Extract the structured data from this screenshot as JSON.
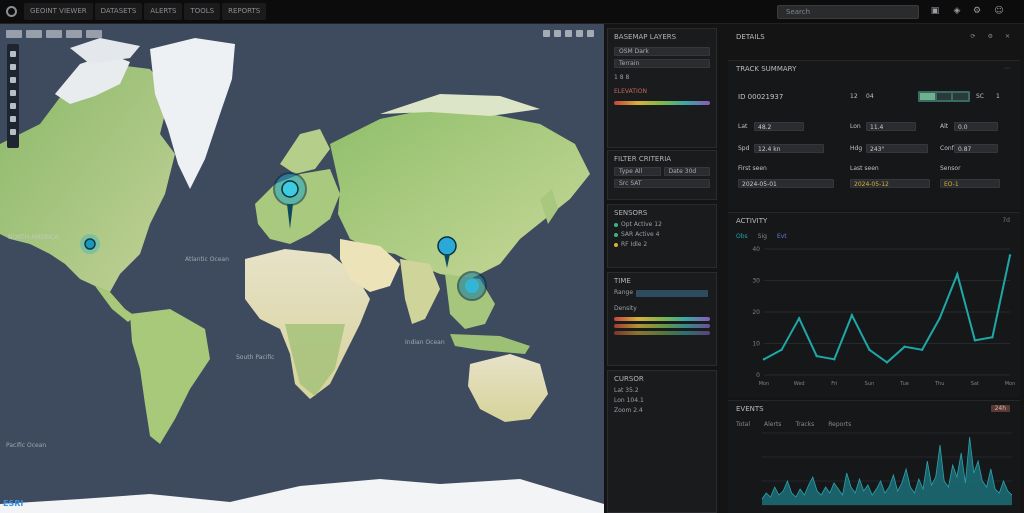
{
  "app": {
    "tabs": [
      "GEOINT VIEWER",
      "DATASETS",
      "ALERTS",
      "TOOLS",
      "REPORTS"
    ],
    "search_placeholder": "Search"
  },
  "map": {
    "attribution": "ESRI",
    "labels": [
      {
        "text": "NORTH AMERICA",
        "class": "ocean"
      },
      {
        "text": "Pacific Ocean",
        "class": "ocean"
      },
      {
        "text": "Atlantic Ocean",
        "class": "ocean"
      },
      {
        "text": "Indian Ocean",
        "class": "ocean"
      },
      {
        "text": "South Pacific",
        "class": "ocean"
      }
    ],
    "markers": [
      {
        "name": "marker-north-america"
      },
      {
        "name": "marker-europe"
      },
      {
        "name": "marker-china"
      },
      {
        "name": "marker-southeast-asia"
      }
    ]
  },
  "layers_panel": {
    "title": "BASEMAP LAYERS",
    "field1": "OSM Dark",
    "field2": "Terrain",
    "row_label": "1 8 8",
    "legend_title": "ELEVATION"
  },
  "filters_panel": {
    "title": "FILTER CRITERIA",
    "items": [
      {
        "k": "Type",
        "v": "All"
      },
      {
        "k": "Date",
        "v": "30d"
      },
      {
        "k": "Src",
        "v": "SAT"
      }
    ]
  },
  "stats_panel": {
    "title": "SENSORS",
    "items": [
      {
        "k": "Opt",
        "v": "Active 12"
      },
      {
        "k": "SAR",
        "v": "Active 4"
      },
      {
        "k": "RF",
        "v": "Idle 2"
      }
    ]
  },
  "timeline_panel": {
    "title": "TIME",
    "slider_label": "Range",
    "bars_label": "Density"
  },
  "coords_panel": {
    "title": "CURSOR",
    "lines": [
      "Lat 35.2",
      "Lon 104.1",
      "Zoom 2.4"
    ]
  },
  "right": {
    "header": "DETAILS",
    "header_icons": [
      "refresh",
      "settings",
      "close"
    ],
    "summary_title": "TRACK SUMMARY",
    "summary_id": "ID 00021937",
    "summary_badges": [
      "12",
      "04",
      "SC",
      "1"
    ],
    "summary_rows": [
      {
        "k": "Lat",
        "v": "48.2"
      },
      {
        "k": "Lon",
        "v": "11.4"
      },
      {
        "k": "Alt",
        "v": "0.0"
      },
      {
        "k": "Spd",
        "v": "12.4 kn"
      },
      {
        "k": "Hdg",
        "v": "243°"
      },
      {
        "k": "Conf",
        "v": "0.87"
      },
      {
        "k": "First seen",
        "v": "2024-05-01"
      },
      {
        "k": "Last seen",
        "v": "2024-05-12"
      },
      {
        "k": "Sensor",
        "v": "EO-1"
      }
    ],
    "activity_title": "ACTIVITY",
    "activity_legend": [
      "Obs",
      "Sig",
      "Evt"
    ],
    "activity_corner": "7d",
    "events_title": "EVENTS",
    "events_corner": "24h",
    "events_legend": [
      "Total",
      "Alerts",
      "Tracks",
      "Reports"
    ]
  },
  "chart_data": [
    {
      "type": "line",
      "x": [
        "Mon",
        "Tue",
        "Wed",
        "Thu",
        "Fri",
        "Sat",
        "Sun",
        "Mon",
        "Tue",
        "Wed",
        "Thu",
        "Fri",
        "Sat",
        "Sun",
        "Mon"
      ],
      "series": [
        {
          "values": [
            5,
            8,
            18,
            6,
            5,
            19,
            8,
            4,
            9,
            8,
            18,
            32,
            11,
            12,
            38
          ]
        }
      ],
      "ylim": [
        0,
        40
      ],
      "yticks": [
        0,
        10,
        20,
        30,
        40
      ],
      "color": "#1fa7a8"
    },
    {
      "type": "area",
      "x_count": 60,
      "series": [
        {
          "values": [
            3,
            6,
            4,
            9,
            5,
            7,
            12,
            6,
            4,
            8,
            5,
            10,
            14,
            7,
            5,
            9,
            6,
            11,
            8,
            5,
            16,
            9,
            6,
            13,
            7,
            10,
            5,
            8,
            12,
            6,
            9,
            15,
            7,
            11,
            18,
            9,
            6,
            13,
            8,
            22,
            10,
            14,
            30,
            12,
            9,
            20,
            14,
            26,
            11,
            34,
            16,
            22,
            12,
            9,
            18,
            8,
            6,
            12,
            7,
            5
          ]
        }
      ],
      "ylim": [
        0,
        36
      ],
      "color": "#1c6f78"
    }
  ]
}
